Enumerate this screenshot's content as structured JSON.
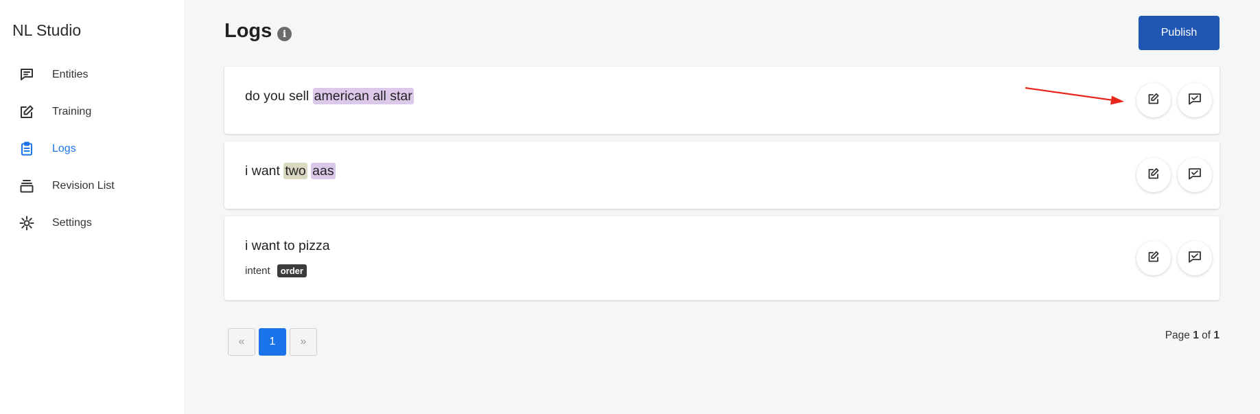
{
  "app": {
    "brand": "NL Studio"
  },
  "sidebar": {
    "items": [
      {
        "label": "Entities",
        "icon": "message-square-icon",
        "active": false
      },
      {
        "label": "Training",
        "icon": "edit-icon",
        "active": false
      },
      {
        "label": "Logs",
        "icon": "clipboard-icon",
        "active": true
      },
      {
        "label": "Revision List",
        "icon": "layers-icon",
        "active": false
      },
      {
        "label": "Settings",
        "icon": "gear-icon",
        "active": false
      }
    ]
  },
  "header": {
    "title": "Logs",
    "info_icon": "i",
    "publish_label": "Publish"
  },
  "logs": [
    {
      "parts": [
        {
          "text": "do you sell ",
          "entity": false
        },
        {
          "text": "american all star",
          "entity": true,
          "color": "#dcc9ea"
        }
      ]
    },
    {
      "parts": [
        {
          "text": "i want ",
          "entity": false
        },
        {
          "text": "two",
          "entity": true,
          "color": "#d9d8c3"
        },
        {
          "text": " ",
          "entity": false
        },
        {
          "text": "aas",
          "entity": true,
          "color": "#dcc9ea"
        }
      ]
    },
    {
      "parts": [
        {
          "text": "i want to pizza",
          "entity": false
        }
      ],
      "intent_label": "intent",
      "intent_value": "order"
    }
  ],
  "pagination": {
    "prev": "«",
    "current": "1",
    "next": "»",
    "info_prefix": "Page ",
    "page": "1",
    "info_of": " of ",
    "total": "1"
  },
  "colors": {
    "accent": "#1a73e8",
    "publish": "#1f55b3",
    "annotation_arrow": "#e8261c"
  }
}
